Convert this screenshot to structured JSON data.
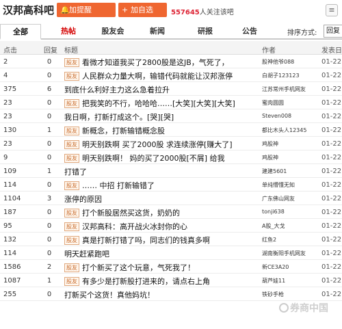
{
  "header": {
    "bar_title": "汉邦高科吧",
    "remind_button": "加提醒",
    "follow_button": "加自选",
    "follow_count": "557645",
    "follow_text": "人关注该吧",
    "remind_icon": "bell-icon",
    "follow_icon": "plus-icon"
  },
  "tabs": [
    {
      "label": "全部",
      "active": true
    },
    {
      "label": "热帖",
      "hot": true
    },
    {
      "label": "股友会"
    },
    {
      "label": "新闻"
    },
    {
      "label": "研报"
    },
    {
      "label": "公告"
    }
  ],
  "sort": {
    "label": "排序方式:",
    "value": "回复"
  },
  "columns": {
    "clicks": "点击",
    "replies": "回复",
    "title": "标题",
    "author": "作者",
    "date": "发表日"
  },
  "badge_text": "股友",
  "rows": [
    {
      "clicks": "2",
      "replies": "0",
      "badge": true,
      "title": "看微才知道我买了2800股是这JB，气死了，",
      "author": "股神他爷088",
      "date": "01-22"
    },
    {
      "clicks": "4",
      "replies": "0",
      "badge": true,
      "title": "人民群众力量大啊，输错代码就能让汉邦涨停",
      "author": "白胡子123123",
      "date": "01-22"
    },
    {
      "clicks": "375",
      "replies": "6",
      "badge": false,
      "title": "到底什么利好主力这么急着拉升",
      "author": "江苏常州手机网友",
      "date": "01-22"
    },
    {
      "clicks": "23",
      "replies": "0",
      "badge": true,
      "title": "把我笑的不行，哈哈哈……[大笑][大笑][大笑]",
      "author": "蜜肉圆圆",
      "date": "01-22"
    },
    {
      "clicks": "23",
      "replies": "0",
      "badge": false,
      "title": "我日啊，打新打成这个。[哭][哭]",
      "author": "Steven008",
      "date": "01-22"
    },
    {
      "clicks": "130",
      "replies": "1",
      "badge": true,
      "title": "新概念，打新输错概念股",
      "author": "都比木头人12345",
      "date": "01-22"
    },
    {
      "clicks": "23",
      "replies": "0",
      "badge": true,
      "title": "明天别跌啊 买了2000股 求连续涨停[赚大了]",
      "author": "鸡股神",
      "date": "01-22"
    },
    {
      "clicks": "9",
      "replies": "0",
      "badge": true,
      "title": "明天别跌啊！ 妈的买了2000股[不屑] 给我",
      "author": "鸡股神",
      "date": "01-22"
    },
    {
      "clicks": "109",
      "replies": "1",
      "badge": false,
      "title": "打错了",
      "author": "建建5601",
      "date": "01-22"
    },
    {
      "clicks": "114",
      "replies": "0",
      "badge": true,
      "title": "…… 中招 打新输错了",
      "author": "单纯懵懂无知",
      "date": "01-22"
    },
    {
      "clicks": "1104",
      "replies": "3",
      "badge": false,
      "title": "涨停的原因",
      "author": "广东佛山网友",
      "date": "01-22"
    },
    {
      "clicks": "187",
      "replies": "0",
      "badge": true,
      "title": "打个新股居然买这货，奶奶的",
      "author": "tonji638",
      "date": "01-22"
    },
    {
      "clicks": "95",
      "replies": "0",
      "badge": true,
      "title": "汉邦高科：高开战火冰封你的心",
      "author": "A股_大戈",
      "date": "01-22"
    },
    {
      "clicks": "132",
      "replies": "0",
      "badge": true,
      "title": "真是打新打错了吗，同志们的钱真多啊",
      "author": "红鱼2",
      "date": "01-22"
    },
    {
      "clicks": "114",
      "replies": "0",
      "badge": false,
      "title": "明天赶紧跑吧",
      "author": "湖南衡阳手机网友",
      "date": "01-22"
    },
    {
      "clicks": "1586",
      "replies": "2",
      "badge": true,
      "title": "打个新买了这个玩意，气死我了！",
      "author": "新CE3A20",
      "date": "01-22"
    },
    {
      "clicks": "1087",
      "replies": "1",
      "badge": true,
      "title": "有多少是打新股打进来的，请点右上角",
      "author": "葫芦娃11",
      "date": "01-22"
    },
    {
      "clicks": "255",
      "replies": "0",
      "badge": false,
      "title": "打新买个这货！真他妈坑！",
      "author": "铁砂手枪",
      "date": "01-22"
    }
  ],
  "watermark": "券商中国",
  "accent_color": "#ef6630"
}
